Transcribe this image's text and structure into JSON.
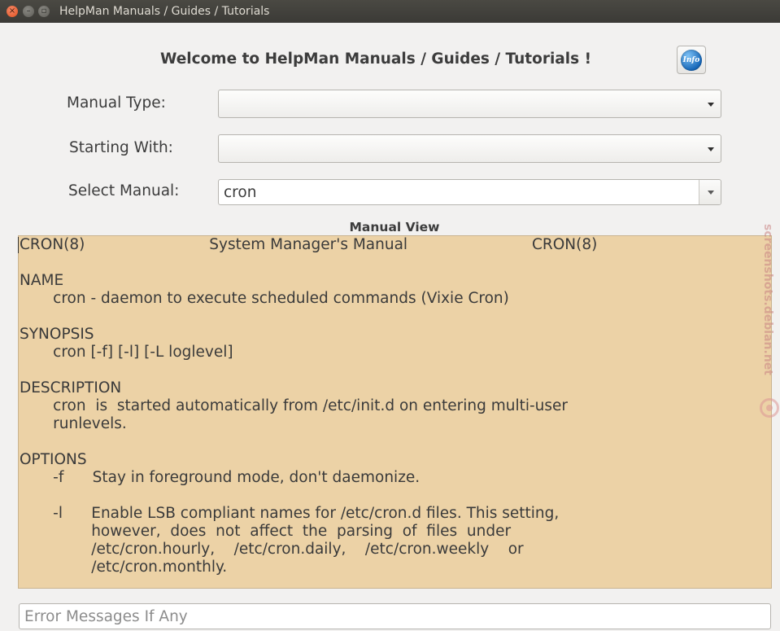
{
  "window": {
    "title": "HelpMan Manuals / Guides / Tutorials",
    "close_glyph": "×",
    "minimize_glyph": "–",
    "maximize_glyph": "▫"
  },
  "header": {
    "welcome": "Welcome to HelpMan Manuals / Guides / Tutorials !",
    "info_label": "Info"
  },
  "form": {
    "manual_type_label": "Manual Type:",
    "manual_type_value": "",
    "starting_with_label": "Starting With:",
    "starting_with_value": "",
    "select_manual_label": "Select Manual:",
    "select_manual_value": "cron"
  },
  "manual_view": {
    "title": "Manual View",
    "content": "CRON(8)                          System Manager's Manual                          CRON(8)\n\nNAME\n       cron - daemon to execute scheduled commands (Vixie Cron)\n\nSYNOPSIS\n       cron [-f] [-l] [-L loglevel]\n\nDESCRIPTION\n       cron  is  started automatically from /etc/init.d on entering multi-user\n       runlevels.\n\nOPTIONS\n       -f      Stay in foreground mode, don't daemonize.\n\n       -l      Enable LSB compliant names for /etc/cron.d files. This setting,\n               however,  does  not  affect  the  parsing  of  files  under\n               /etc/cron.hourly,    /etc/cron.daily,    /etc/cron.weekly    or\n               /etc/cron.monthly."
  },
  "error": {
    "placeholder": "Error Messages If Any",
    "value": ""
  },
  "watermark": {
    "text": "screenshots.debian.net"
  },
  "icons": {
    "info": "info-globe-icon",
    "dropdown": "chevron-down-icon"
  }
}
